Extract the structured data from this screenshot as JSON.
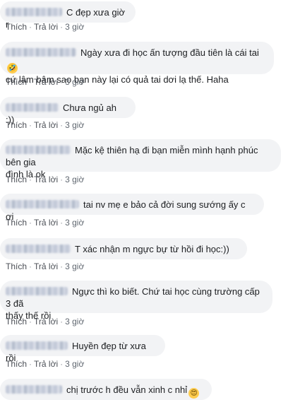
{
  "actions": {
    "like": "Thích",
    "reply": "Trả lời",
    "dot": "·",
    "time": "3 giờ"
  },
  "comments": [
    {
      "text": "C đẹp xưa giờ r"
    },
    {
      "text": "Ngày xưa đi học ấn tượng đầu tiên là cái tai",
      "text2": "cứ lâm bâm sao bạn này lại có quả tai dơi lạ thế. Haha",
      "emoji": "rolling-on-floor-laughing-icon"
    },
    {
      "text": "Chưa ngủ ah :))"
    },
    {
      "text": "Mặc kệ thiên hạ đi bạn miễn mình hạnh phúc bên gia",
      "text2": "đình là ok"
    },
    {
      "text": "tai nv mẹ e bảo cả đời sung sướng ấy c ơi"
    },
    {
      "text": "T xác nhận m ngực bự từ hồi đi học:))"
    },
    {
      "text": "Ngực thì ko biết. Chứ tai học cùng trường cấp 3 đã",
      "text2": "thấy thế rồi"
    },
    {
      "text": "Huyền đẹp từ xưa rồi"
    },
    {
      "text": "chị trước h đều vẫn xinh c nhỉ",
      "emoji": "heart-eyes-icon"
    }
  ]
}
